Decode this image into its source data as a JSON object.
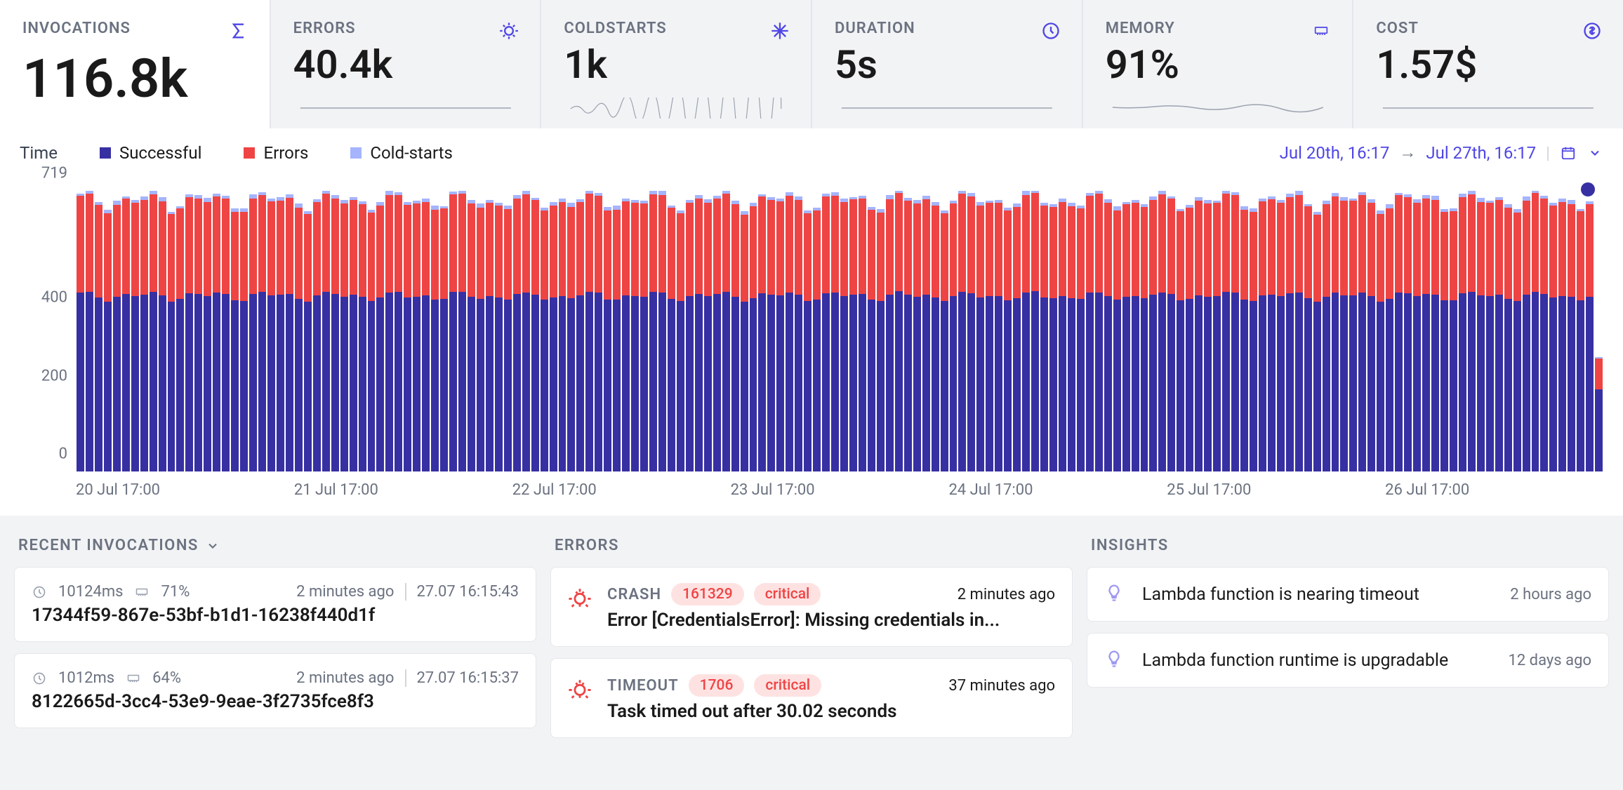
{
  "kpis": [
    {
      "label": "INVOCATIONS",
      "value": "116.8k",
      "icon": "sigma",
      "active": true
    },
    {
      "label": "ERRORS",
      "value": "40.4k",
      "icon": "bug"
    },
    {
      "label": "COLDSTARTS",
      "value": "1k",
      "icon": "snowflake"
    },
    {
      "label": "DURATION",
      "value": "5s",
      "icon": "clock"
    },
    {
      "label": "MEMORY",
      "value": "91%",
      "icon": "memory"
    },
    {
      "label": "COST",
      "value": "1.57$",
      "icon": "dollar"
    }
  ],
  "legend": {
    "time_label": "Time",
    "items": [
      {
        "label": "Successful",
        "color": "#3730a3"
      },
      {
        "label": "Errors",
        "color": "#ef4444"
      },
      {
        "label": "Cold-starts",
        "color": "#a5b4fc"
      }
    ]
  },
  "daterange": {
    "from": "Jul 20th, 16:17",
    "to": "Jul 27th, 16:17"
  },
  "chart_data": {
    "type": "bar",
    "stacked": true,
    "ylim": [
      0,
      719
    ],
    "yticks": [
      0,
      200,
      400,
      719
    ],
    "xticks": [
      "20 Jul 17:00",
      "21 Jul 17:00",
      "22 Jul 17:00",
      "23 Jul 17:00",
      "24 Jul 17:00",
      "25 Jul 17:00",
      "26 Jul 17:00"
    ],
    "n_bars": 168,
    "approx_per_bar": {
      "successful": 450,
      "errors": 240,
      "coldstarts": 6
    },
    "last_bar": {
      "successful": 210,
      "errors": 80,
      "coldstarts": 3
    },
    "series_order": [
      "successful",
      "errors",
      "coldstarts"
    ],
    "series_colors": {
      "successful": "#3730a3",
      "errors": "#ef4444",
      "coldstarts": "#a5b4fc"
    },
    "title": "",
    "xlabel": "",
    "ylabel": ""
  },
  "panels": {
    "recent_title": "RECENT INVOCATIONS",
    "errors_title": "ERRORS",
    "insights_title": "INSIGHTS"
  },
  "recent_invocations": [
    {
      "duration": "10124ms",
      "memory": "71%",
      "rel_time": "2 minutes ago",
      "abs_time": "27.07 16:15:43",
      "id": "17344f59-867e-53bf-b1d1-16238f440d1f"
    },
    {
      "duration": "1012ms",
      "memory": "64%",
      "rel_time": "2 minutes ago",
      "abs_time": "27.07 16:15:37",
      "id": "8122665d-3cc4-53e9-9eae-3f2735fce8f3"
    }
  ],
  "errors": [
    {
      "type": "CRASH",
      "count": "161329",
      "severity": "critical",
      "rel_time": "2 minutes ago",
      "message": "Error [CredentialsError]: Missing credentials in..."
    },
    {
      "type": "TIMEOUT",
      "count": "1706",
      "severity": "critical",
      "rel_time": "37 minutes ago",
      "message": "Task timed out after 30.02 seconds"
    }
  ],
  "insights": [
    {
      "text": "Lambda function is nearing timeout",
      "rel_time": "2 hours ago"
    },
    {
      "text": "Lambda function runtime is upgradable",
      "rel_time": "12 days ago"
    }
  ]
}
